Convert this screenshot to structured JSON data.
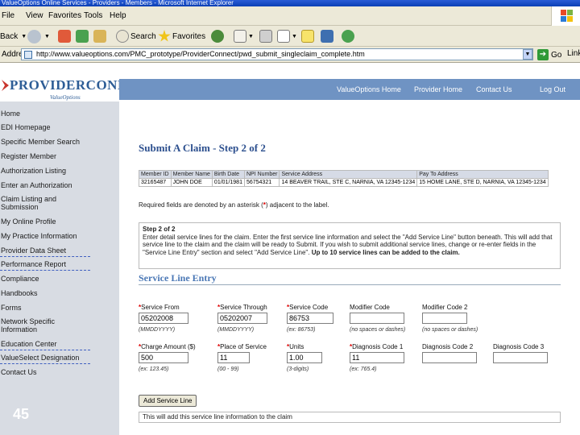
{
  "window": {
    "title": "ValueOptions Online Services - Providers - Members - Microsoft Internet Explorer"
  },
  "menubar": {
    "items": [
      "File",
      "View",
      "Favorites",
      "Tools",
      "Help"
    ]
  },
  "toolbar": {
    "back": "Back",
    "search": "Search",
    "favorites": "Favorites"
  },
  "address": {
    "label": "Address",
    "url": "http://www.valueoptions.com/PMC_prototype/ProviderConnect/pwd_submit_singleclaim_complete.htm",
    "go": "Go",
    "links": "Links"
  },
  "brand": {
    "logo_text": "PROVIDERCONNECT",
    "logo_sub": "ValueOptions",
    "colors": {
      "nav": "#6f93c3",
      "heading": "#2c4f8e",
      "required": "#d00000"
    }
  },
  "nav": {
    "links": [
      "ValueOptions Home",
      "Provider Home",
      "Contact Us",
      "Log Out"
    ]
  },
  "sidebar": {
    "items": [
      "Home",
      "EDI Homepage",
      "Specific Member Search",
      "Register Member",
      "Authorization Listing",
      "Enter an Authorization",
      "Claim Listing and Submission",
      "My Online Profile",
      "My Practice Information",
      "Provider Data Sheet",
      "Performance Report",
      "Compliance",
      "Handbooks",
      "Forms",
      "Network Specific Information",
      "Education Center",
      "ValueSelect Designation",
      "Contact Us"
    ]
  },
  "slide_number": "45",
  "main": {
    "title": "Submit A Claim - Step 2 of 2",
    "claim_table": {
      "headers": [
        "Member ID",
        "Member Name",
        "Birth Date",
        "NPI Number",
        "Service Address",
        "Pay To Address"
      ],
      "row": [
        "32165487",
        "JOHN DOE",
        "01/01/1981",
        "56754321",
        "14 BEAVER TRAIL, STE C, NARNIA, VA 12345-1234",
        "15 HOME LANE, STE D, NARNIA, VA 12345-1234"
      ]
    },
    "required_note": {
      "before": "Required fields are denoted by an asterisk (",
      "star": "*",
      "after": ") adjacent to the label."
    },
    "info_box": {
      "heading": "Step 2 of 2",
      "body": "Enter detail service lines for the claim. Enter the first service line information and select the \"Add Service Line\" button beneath. This will add that service line to the claim and the claim will be ready to Submit. If you wish to submit additional service lines, change or re-enter fields in the \"Service Line Entry\" section and select \"Add Service Line\".",
      "bold_tail": "Up to 10 service lines can be added to the claim."
    },
    "service_line": {
      "title": "Service Line Entry",
      "fields": {
        "service_from": {
          "label": "Service From",
          "value": "05202008",
          "hint": "(MMDDYYYY)"
        },
        "service_through": {
          "label": "Service Through",
          "value": "05202007",
          "hint": "(MMDDYYYY)"
        },
        "service_code": {
          "label": "Service Code",
          "value": "86753",
          "hint": "(ex: 86753)"
        },
        "modifier_code": {
          "label": "Modifier Code",
          "value": "",
          "hint": "(no spaces or dashes)"
        },
        "modifier_code_2": {
          "label": "Modifier Code 2",
          "value": "",
          "hint": "(no spaces or dashes)"
        },
        "charge_amount": {
          "label": "Charge Amount ($)",
          "value": "500",
          "hint": "(ex: 123.45)"
        },
        "place_of_service": {
          "label": "Place of Service",
          "value": "11",
          "hint": "(00 - 99)"
        },
        "units": {
          "label": "Units",
          "value": "1.00",
          "hint": "(3-digits)"
        },
        "diagnosis_code_1": {
          "label": "Diagnosis Code 1",
          "value": "11",
          "hint": "(ex: 765.4)"
        },
        "diagnosis_code_2": {
          "label": "Diagnosis Code 2",
          "value": ""
        },
        "diagnosis_code_3": {
          "label": "Diagnosis Code 3",
          "value": ""
        }
      },
      "add_button": "Add Service Line",
      "footer_note": "This will add this service line information to the claim"
    }
  }
}
